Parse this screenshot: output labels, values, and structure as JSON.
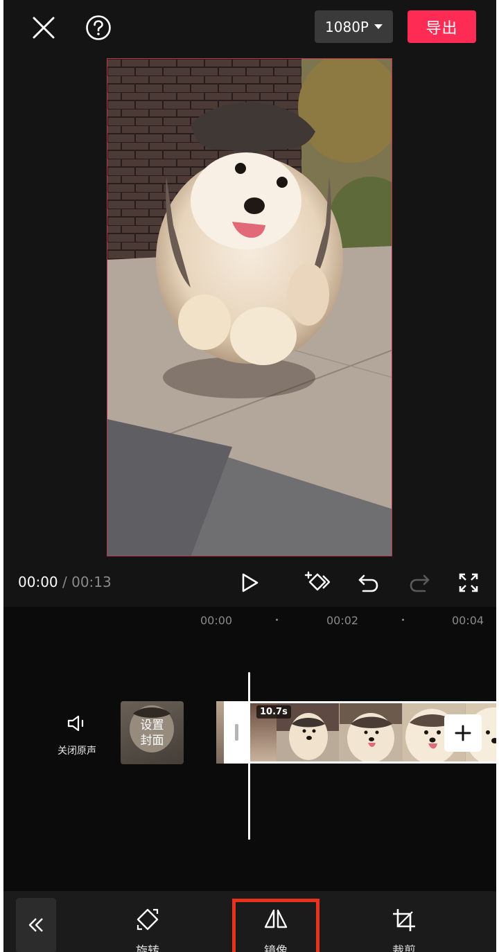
{
  "header": {
    "close_icon": "close-icon",
    "help_icon": "help-icon",
    "resolution": "1080P",
    "export_label": "导出"
  },
  "playback": {
    "current_time": "00:00",
    "separator": " / ",
    "total_time": "00:13",
    "icons": [
      "play-icon",
      "keyframe-icon",
      "undo-icon",
      "redo-icon",
      "fullscreen-icon"
    ]
  },
  "timeline": {
    "ticks": [
      "00:00",
      "00:02",
      "00:04"
    ],
    "mute_label": "关闭原声",
    "cover_label_line1": "设置",
    "cover_label_line2": "封面",
    "clip_duration": "10.7s"
  },
  "toolbar": {
    "items": [
      {
        "label": "旋转",
        "icon": "rotate-icon"
      },
      {
        "label": "镜像",
        "icon": "mirror-icon"
      },
      {
        "label": "裁剪",
        "icon": "crop-icon"
      }
    ]
  },
  "colors": {
    "accent": "#fe2c55",
    "highlight": "#e8321c",
    "background": "#141414"
  }
}
